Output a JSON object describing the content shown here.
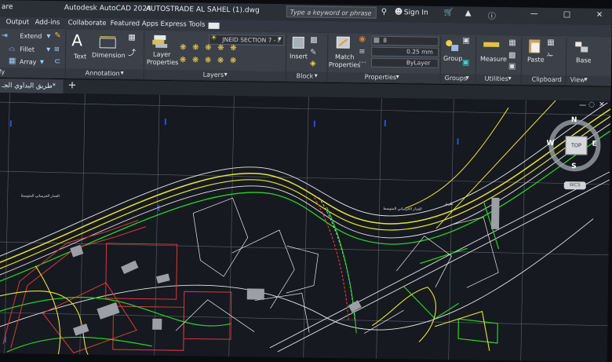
{
  "titlebar": {
    "left_fragment": "are",
    "app_title": "Autodesk AutoCAD 2024",
    "file_name": "AUTOSTRADE AL SAHEL (1).dwg",
    "search_placeholder": "Type a keyword or phrase",
    "sign_in": "Sign In",
    "icons": [
      "search-icon",
      "user-icon",
      "cart-icon",
      "help-icon",
      "minimize-icon",
      "restore-icon",
      "close-icon"
    ]
  },
  "menubar": {
    "items": [
      "Output",
      "Add-ins",
      "Collaborate",
      "Featured Apps",
      "Express Tools"
    ]
  },
  "ribbon": {
    "modify": {
      "extend": "Extend",
      "fillet": "Fillet",
      "array": "Array"
    },
    "annotation": {
      "text": "Text",
      "dimension": "Dimension",
      "label": "Annotation"
    },
    "layers": {
      "layer_properties_1": "Layer",
      "layer_properties_2": "Properties",
      "layer_dropdown": "JNEID SECTION 7 - I",
      "label": "Layers"
    },
    "block": {
      "insert": "Insert",
      "label": "Block"
    },
    "properties": {
      "match_1": "Match",
      "match_2": "Properties",
      "color_value": "8",
      "lineweight": "0.25 mm",
      "linetype": "ByLayer",
      "label": "Properties"
    },
    "groups": {
      "group": "Group",
      "label": "Groups"
    },
    "utilities": {
      "measure": "Measure",
      "label": "Utilities"
    },
    "clipboard": {
      "paste": "Paste",
      "label": "Clipboard"
    },
    "view": {
      "base": "Base",
      "label": "View"
    },
    "left_panel_fragment": "fy"
  },
  "document": {
    "tab_label": "طريق البداوي الجـ*",
    "plus": "+"
  },
  "viewcube": {
    "top": "TOP",
    "north": "N",
    "south": "S",
    "west": "W",
    "east": "E",
    "wcs": "WCS"
  },
  "canvas": {
    "annotations": [
      "الجدار الخرساني المتوسط",
      "الجدار الخرساني المتوسط",
      "طريق"
    ]
  },
  "colors": {
    "yellow": "#e6e23a",
    "green": "#2ad12a",
    "red": "#d83a3a",
    "white": "#e8e8e8",
    "blue": "#2a4fd6",
    "grid": "#6d7480"
  }
}
